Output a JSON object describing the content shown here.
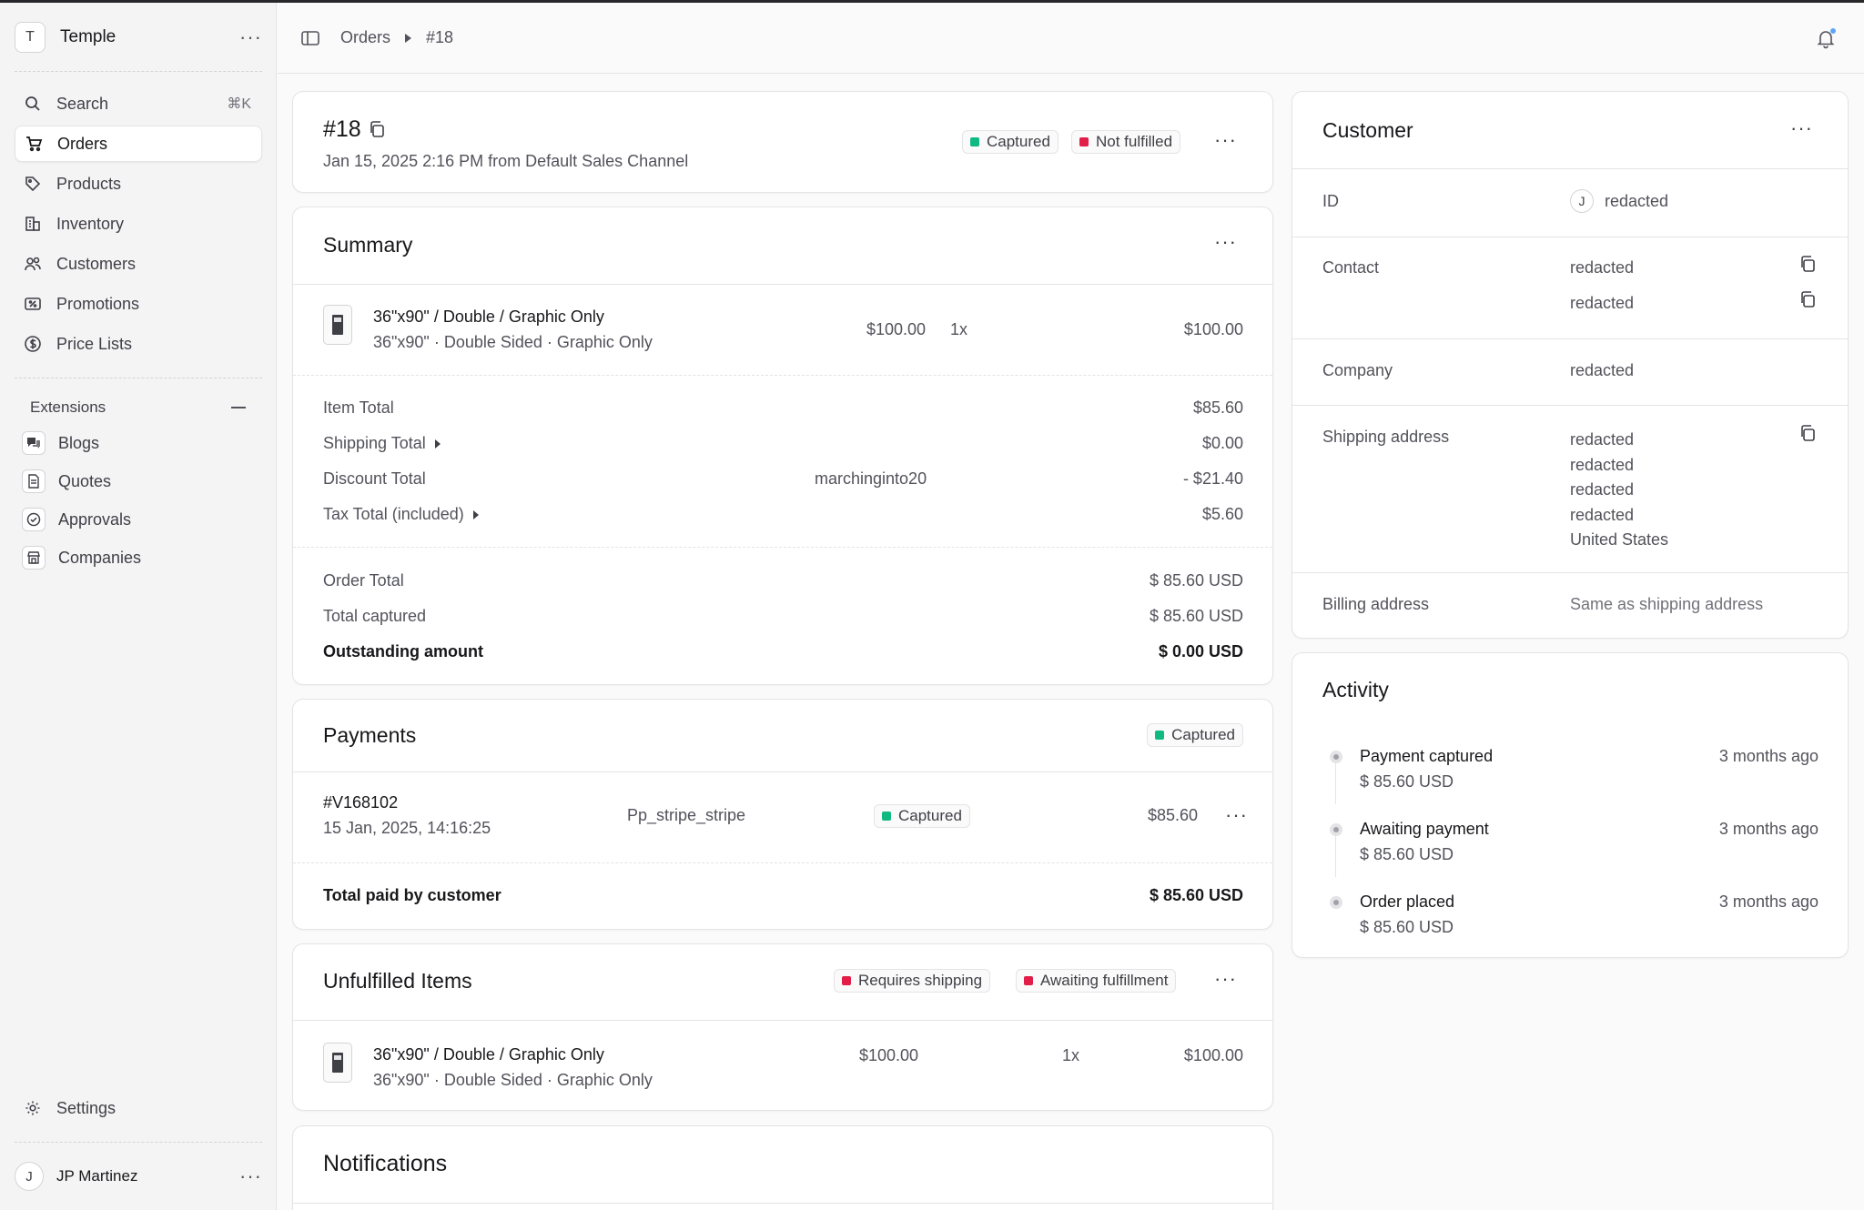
{
  "sidebar": {
    "store_initial": "T",
    "store_name": "Temple",
    "items": [
      {
        "label": "Search",
        "kbd": "⌘K"
      },
      {
        "label": "Orders"
      },
      {
        "label": "Products"
      },
      {
        "label": "Inventory"
      },
      {
        "label": "Customers"
      },
      {
        "label": "Promotions"
      },
      {
        "label": "Price Lists"
      }
    ],
    "extensions_label": "Extensions",
    "extensions": [
      {
        "label": "Blogs"
      },
      {
        "label": "Quotes"
      },
      {
        "label": "Approvals"
      },
      {
        "label": "Companies"
      }
    ],
    "settings_label": "Settings",
    "user_initial": "J",
    "user_name": "JP Martinez"
  },
  "breadcrumb": {
    "root": "Orders",
    "current": "#18"
  },
  "order": {
    "id": "#18",
    "meta": "Jan 15, 2025 2:16 PM from Default Sales Channel",
    "payment_badge": "Captured",
    "fulfillment_badge": "Not fulfilled"
  },
  "summary": {
    "title": "Summary",
    "item": {
      "name": "36\"x90\" / Double / Graphic Only",
      "variant": "36\"x90\" · Double Sided · Graphic Only",
      "unit_price": "$100.00",
      "qty": "1x",
      "total": "$100.00"
    },
    "rows": [
      {
        "label": "Item Total",
        "extra": "",
        "value": "$85.60"
      },
      {
        "label": "Shipping Total",
        "extra": "",
        "value": "$0.00"
      },
      {
        "label": "Discount Total",
        "extra": "marchinginto20",
        "value": "- $21.40"
      },
      {
        "label": "Tax Total (included)",
        "extra": "",
        "value": "$5.60"
      }
    ],
    "totals": [
      {
        "label": "Order Total",
        "value": "$ 85.60 USD"
      },
      {
        "label": "Total captured",
        "value": "$ 85.60 USD"
      },
      {
        "label": "Outstanding amount",
        "value": "$ 0.00 USD"
      }
    ]
  },
  "payments": {
    "title": "Payments",
    "badge": "Captured",
    "payment": {
      "id": "#V168102",
      "date": "15 Jan, 2025, 14:16:25",
      "provider": "Pp_stripe_stripe",
      "status": "Captured",
      "amount": "$85.60"
    },
    "total_label": "Total paid by customer",
    "total_value": "$ 85.60 USD"
  },
  "unfulfilled": {
    "title": "Unfulfilled Items",
    "badge_shipping": "Requires shipping",
    "badge_fulfillment": "Awaiting fulfillment",
    "item": {
      "name": "36\"x90\" / Double / Graphic Only",
      "variant": "36\"x90\" · Double Sided · Graphic Only",
      "unit_price": "$100.00",
      "qty": "1x",
      "total": "$100.00"
    }
  },
  "notifications": {
    "title": "Notifications"
  },
  "customer": {
    "title": "Customer",
    "id_label": "ID",
    "id_initial": "J",
    "id_value": "redacted",
    "contact_label": "Contact",
    "contact_email": "redacted",
    "contact_phone": "redacted",
    "company_label": "Company",
    "company_value": "redacted",
    "shipping_label": "Shipping address",
    "shipping_lines": [
      "redacted",
      "redacted",
      "redacted",
      "redacted",
      "United States"
    ],
    "billing_label": "Billing address",
    "billing_value": "Same as shipping address"
  },
  "activity": {
    "title": "Activity",
    "events": [
      {
        "title": "Payment captured",
        "amount": "$ 85.60 USD",
        "time": "3 months ago"
      },
      {
        "title": "Awaiting payment",
        "amount": "$ 85.60 USD",
        "time": "3 months ago"
      },
      {
        "title": "Order placed",
        "amount": "$ 85.60 USD",
        "time": "3 months ago"
      }
    ]
  }
}
